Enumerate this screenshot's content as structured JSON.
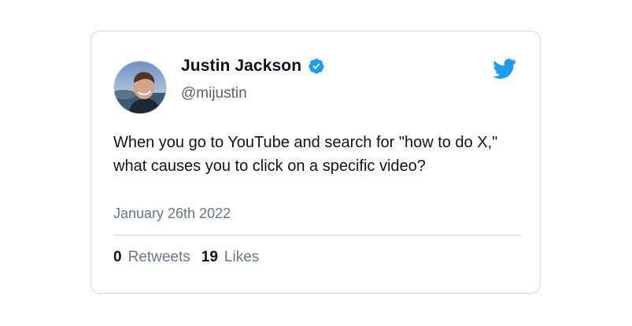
{
  "tweet": {
    "author_name": "Justin Jackson",
    "author_handle": "@mijustin",
    "verified_icon": "verified-badge-icon",
    "brand_icon": "twitter-bird-icon",
    "text": "When you go to YouTube and search for \"how to do X,\" what causes you to click on a specific video?",
    "date": "January 26th 2022",
    "retweets_count": "0",
    "retweets_label": "Retweets",
    "likes_count": "19",
    "likes_label": "Likes"
  },
  "colors": {
    "accent": "#1d9bf0",
    "text_primary": "#0f1419",
    "text_secondary": "#66788a",
    "border": "#cfd9de"
  }
}
